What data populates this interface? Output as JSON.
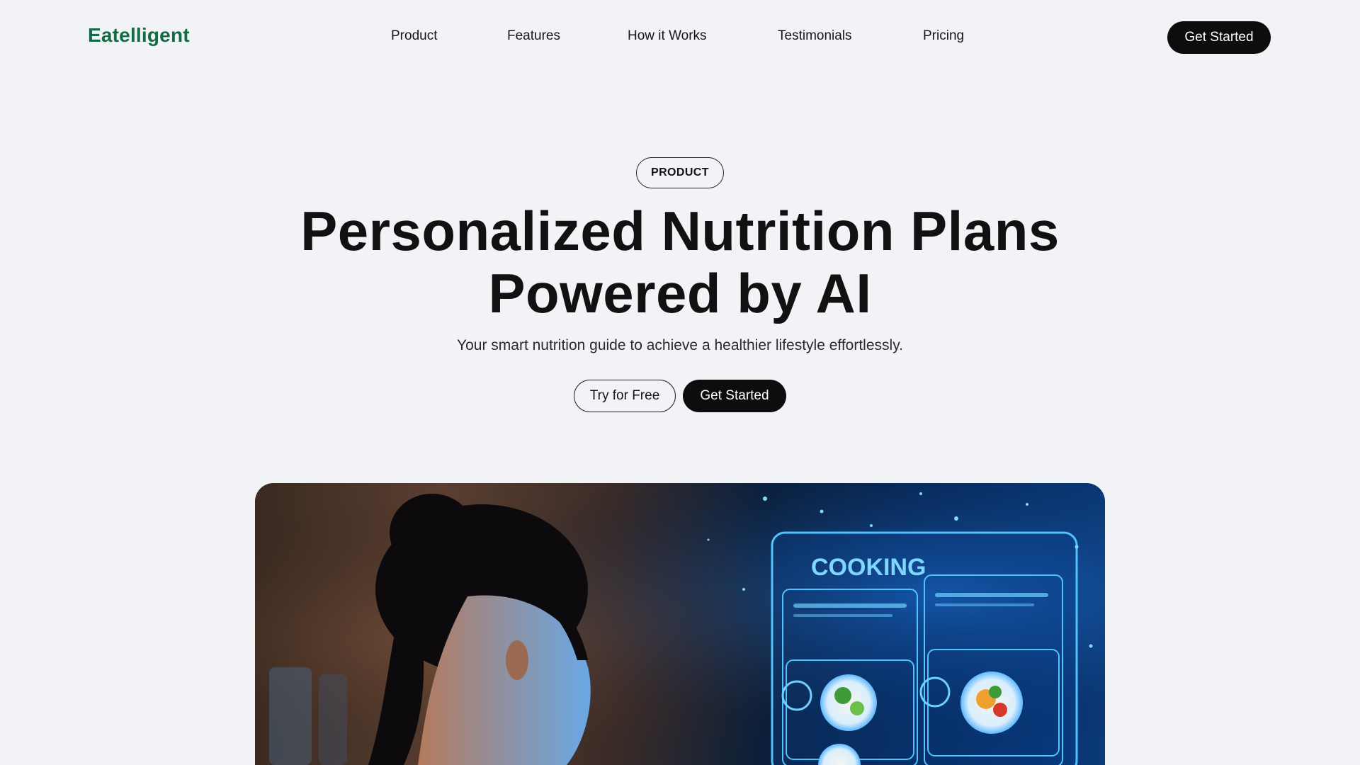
{
  "brand": {
    "name": "Eatelligent",
    "color": "#146b43"
  },
  "nav": {
    "items": [
      {
        "label": "Product"
      },
      {
        "label": "Features"
      },
      {
        "label": "How it Works"
      },
      {
        "label": "Testimonials"
      },
      {
        "label": "Pricing"
      }
    ],
    "cta_label": "Get Started"
  },
  "hero": {
    "badge": "PRODUCT",
    "title_line1": "Personalized Nutrition Plans",
    "title_line2": "Powered by AI",
    "subtitle": "Your smart nutrition guide to achieve a healthier lifestyle effortlessly.",
    "primary_cta": "Try for Free",
    "secondary_cta": "Get Started"
  },
  "image": {
    "screen_heading": "COOKING"
  }
}
